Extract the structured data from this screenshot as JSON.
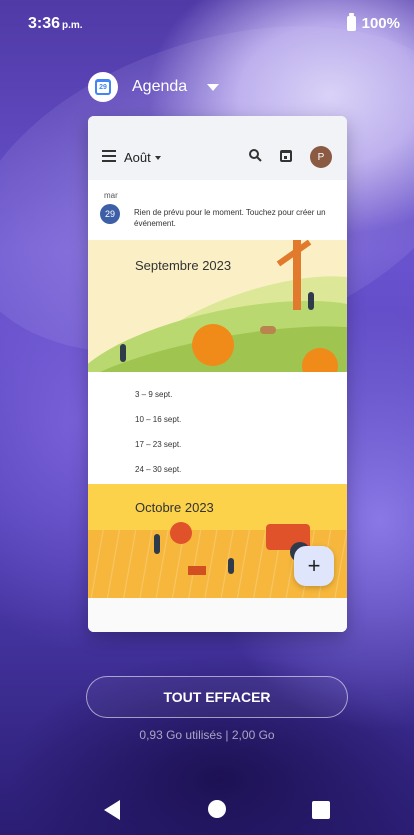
{
  "status_bar": {
    "time": "3:36",
    "ampm": "p.m.",
    "battery": "100%"
  },
  "recent_app": {
    "name": "Agenda",
    "icon_day": "29",
    "toolbar": {
      "month": "Août"
    },
    "avatar_letter": "P",
    "event": {
      "day_abbr": "mar",
      "day_num": "29",
      "text": "Rien de prévu pour le moment. Touchez pour créer un événement."
    },
    "months": [
      {
        "title": "Septembre 2023",
        "weeks": [
          "3 – 9 sept.",
          "10 – 16 sept.",
          "17 – 23 sept.",
          "24 – 30 sept."
        ]
      },
      {
        "title": "Octobre 2023"
      }
    ],
    "fab_symbol": "+"
  },
  "actions": {
    "clear_all": "TOUT EFFACER",
    "memory": "0,93 Go utilisés | 2,00 Go"
  },
  "colors": {
    "accent_blue": "#3c5fa8",
    "avatar": "#8b5a42",
    "fab_bg": "#dfe5fb"
  },
  "icons": [
    "menu-icon",
    "search-icon",
    "calendar-icon",
    "back-icon",
    "home-icon",
    "recents-icon",
    "add-icon"
  ]
}
